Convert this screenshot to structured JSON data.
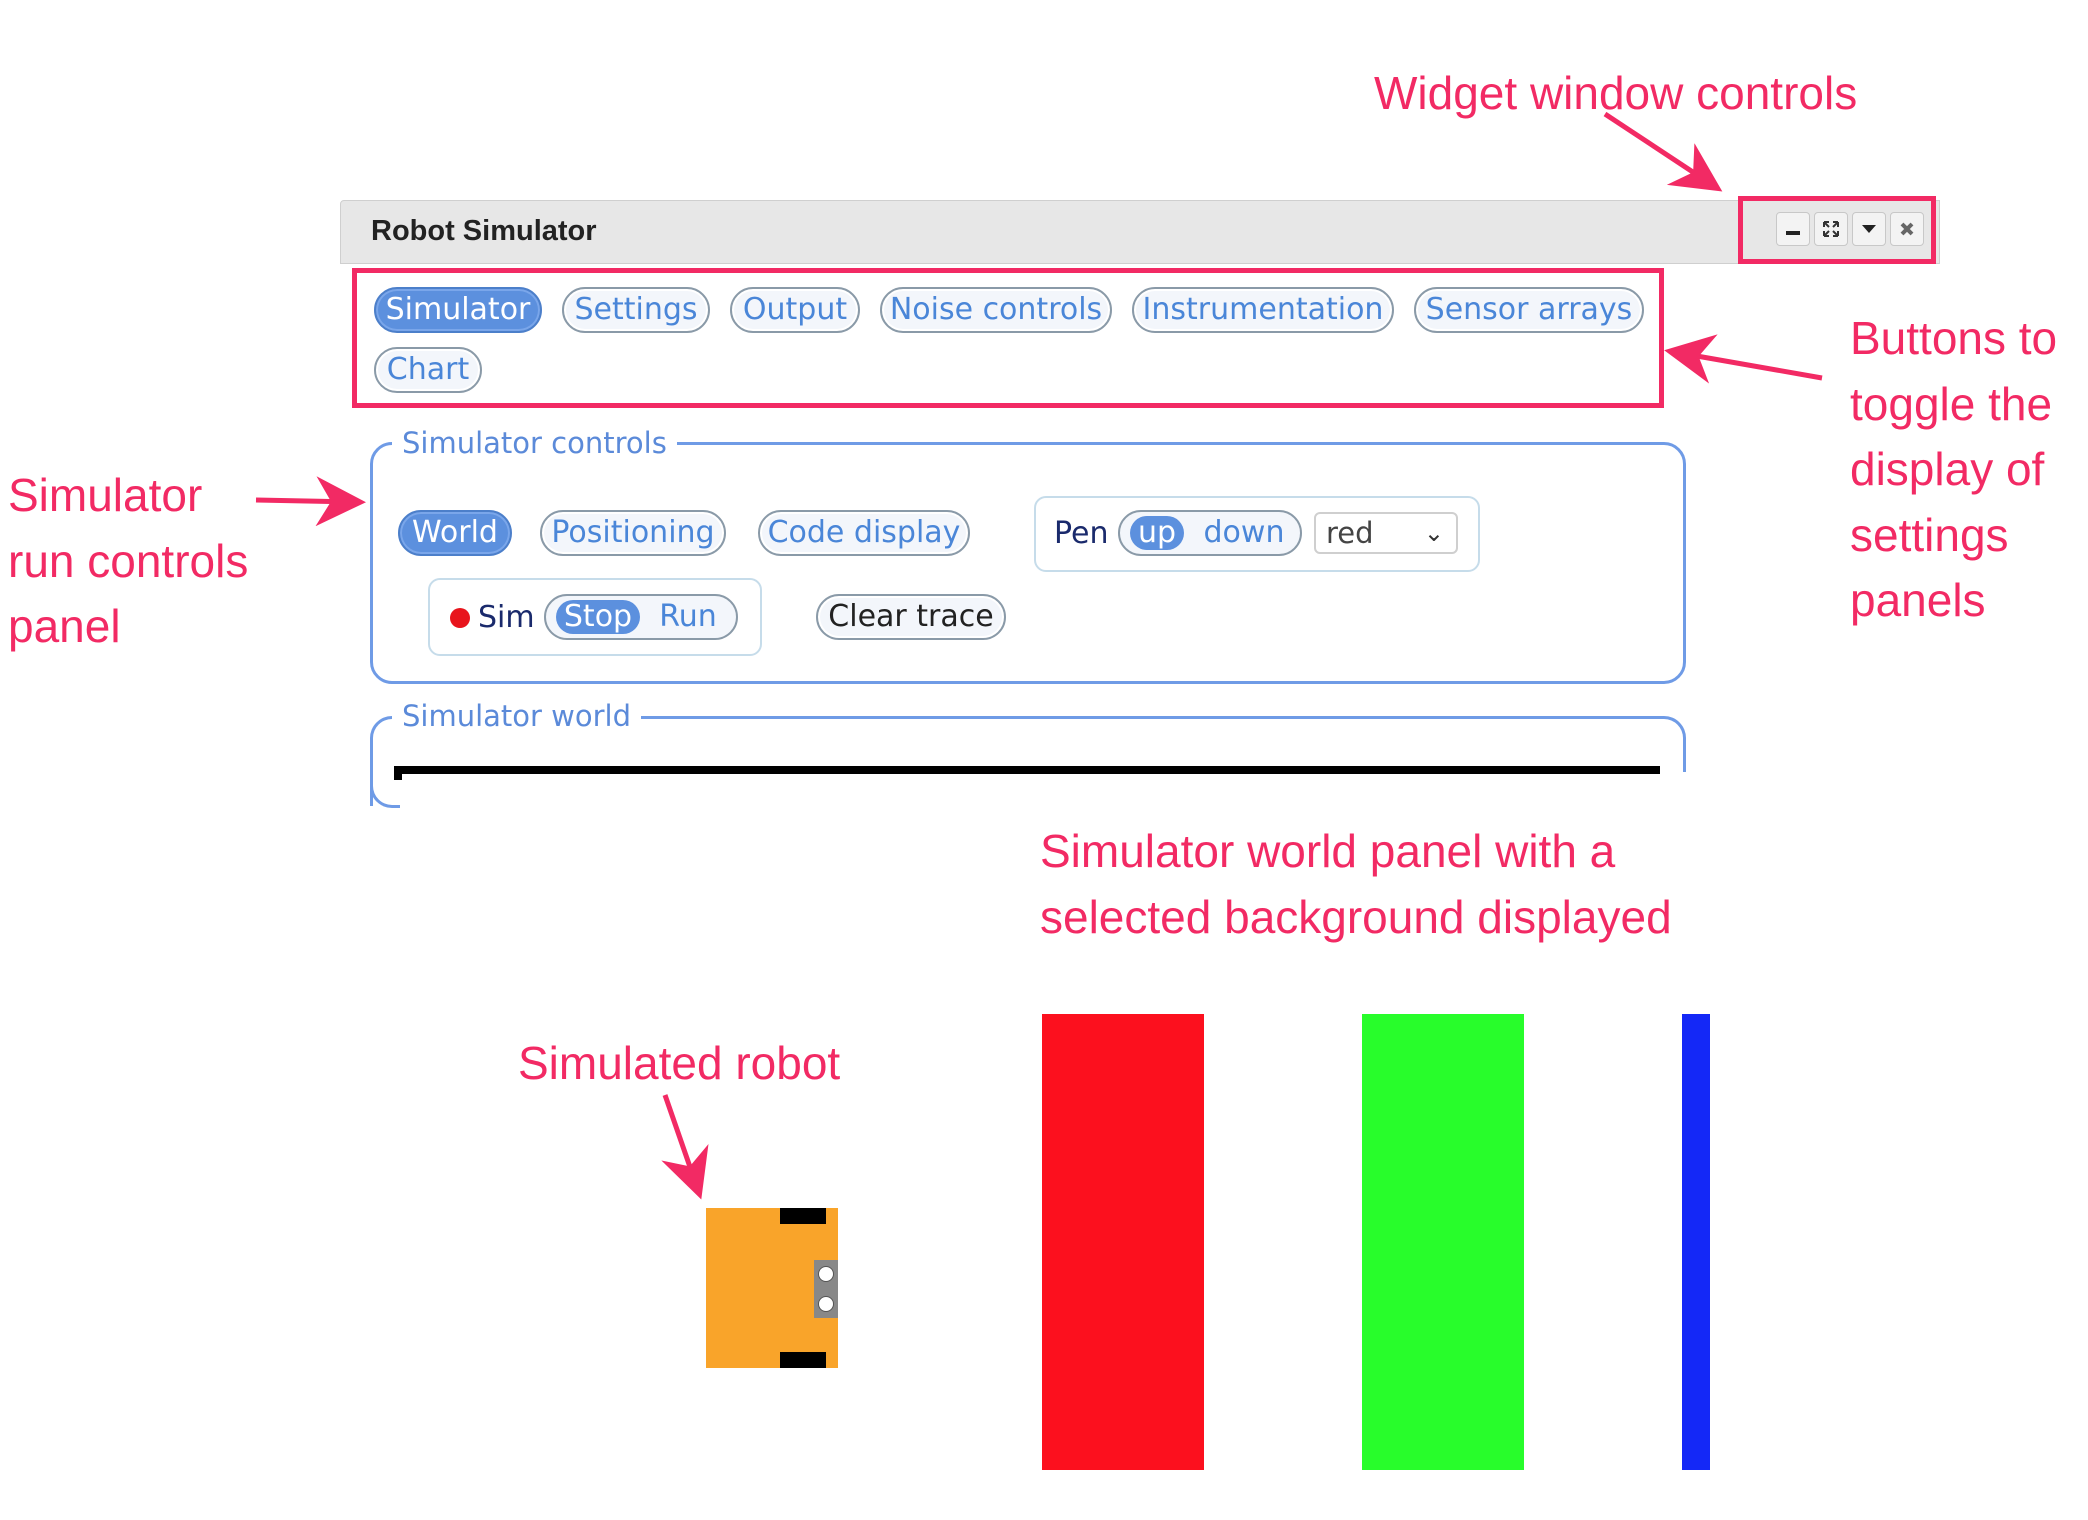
{
  "annotations": {
    "window_controls": "Widget window controls",
    "toggle_buttons": [
      "Buttons to",
      "toggle the",
      "display of",
      "settings",
      "panels"
    ],
    "run_controls": [
      "Simulator",
      "run controls",
      "panel"
    ],
    "world_panel": [
      "Simulator world panel with a",
      "selected background displayed"
    ],
    "robot": "Simulated robot"
  },
  "window": {
    "title": "Robot Simulator",
    "controls": {
      "minimize_icon": "minimize-icon",
      "expand_icon": "expand-icon",
      "menu_icon": "chevron-down-icon",
      "close_icon": "close-icon"
    }
  },
  "tabs": [
    {
      "label": "Simulator",
      "active": true
    },
    {
      "label": "Settings",
      "active": false
    },
    {
      "label": "Output",
      "active": false
    },
    {
      "label": "Noise controls",
      "active": false
    },
    {
      "label": "Instrumentation",
      "active": false
    },
    {
      "label": "Sensor arrays",
      "active": false
    },
    {
      "label": "Chart",
      "active": false
    }
  ],
  "simulator_controls": {
    "legend": "Simulator controls",
    "buttons": [
      {
        "label": "World",
        "active": true
      },
      {
        "label": "Positioning",
        "active": false
      },
      {
        "label": "Code display",
        "active": false
      }
    ],
    "pen": {
      "label": "Pen",
      "options": [
        "up",
        "down"
      ],
      "selected": "up",
      "color_value": "red"
    },
    "sim": {
      "label": "Sim",
      "options": [
        "Stop",
        "Run"
      ],
      "selected": "Stop",
      "status_color": "#e8141c"
    },
    "clear_trace": "Clear trace"
  },
  "simulator_world": {
    "legend": "Simulator world",
    "background_colors": [
      "#fc101e",
      "#28fd2b",
      "#1428f7"
    ],
    "robot_color": "#f9a42a"
  },
  "colors": {
    "annotation": "#f22a64",
    "accent": "#5c90de"
  }
}
